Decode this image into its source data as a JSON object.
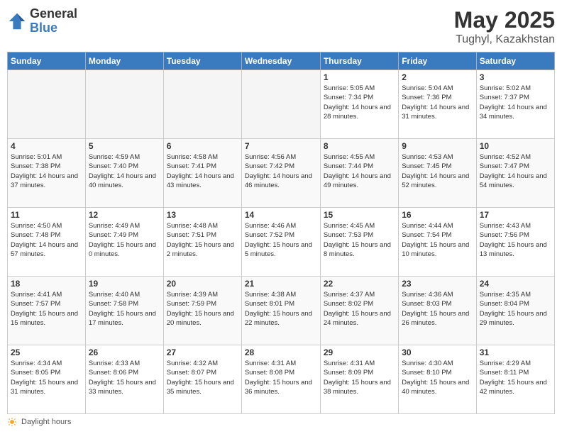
{
  "header": {
    "logo_general": "General",
    "logo_blue": "Blue",
    "month_year": "May 2025",
    "location": "Tughyl, Kazakhstan"
  },
  "days_of_week": [
    "Sunday",
    "Monday",
    "Tuesday",
    "Wednesday",
    "Thursday",
    "Friday",
    "Saturday"
  ],
  "weeks": [
    [
      {
        "day": "",
        "sunrise": "",
        "sunset": "",
        "daylight": ""
      },
      {
        "day": "",
        "sunrise": "",
        "sunset": "",
        "daylight": ""
      },
      {
        "day": "",
        "sunrise": "",
        "sunset": "",
        "daylight": ""
      },
      {
        "day": "",
        "sunrise": "",
        "sunset": "",
        "daylight": ""
      },
      {
        "day": "1",
        "sunrise": "Sunrise: 5:05 AM",
        "sunset": "Sunset: 7:34 PM",
        "daylight": "Daylight: 14 hours and 28 minutes."
      },
      {
        "day": "2",
        "sunrise": "Sunrise: 5:04 AM",
        "sunset": "Sunset: 7:36 PM",
        "daylight": "Daylight: 14 hours and 31 minutes."
      },
      {
        "day": "3",
        "sunrise": "Sunrise: 5:02 AM",
        "sunset": "Sunset: 7:37 PM",
        "daylight": "Daylight: 14 hours and 34 minutes."
      }
    ],
    [
      {
        "day": "4",
        "sunrise": "Sunrise: 5:01 AM",
        "sunset": "Sunset: 7:38 PM",
        "daylight": "Daylight: 14 hours and 37 minutes."
      },
      {
        "day": "5",
        "sunrise": "Sunrise: 4:59 AM",
        "sunset": "Sunset: 7:40 PM",
        "daylight": "Daylight: 14 hours and 40 minutes."
      },
      {
        "day": "6",
        "sunrise": "Sunrise: 4:58 AM",
        "sunset": "Sunset: 7:41 PM",
        "daylight": "Daylight: 14 hours and 43 minutes."
      },
      {
        "day": "7",
        "sunrise": "Sunrise: 4:56 AM",
        "sunset": "Sunset: 7:42 PM",
        "daylight": "Daylight: 14 hours and 46 minutes."
      },
      {
        "day": "8",
        "sunrise": "Sunrise: 4:55 AM",
        "sunset": "Sunset: 7:44 PM",
        "daylight": "Daylight: 14 hours and 49 minutes."
      },
      {
        "day": "9",
        "sunrise": "Sunrise: 4:53 AM",
        "sunset": "Sunset: 7:45 PM",
        "daylight": "Daylight: 14 hours and 52 minutes."
      },
      {
        "day": "10",
        "sunrise": "Sunrise: 4:52 AM",
        "sunset": "Sunset: 7:47 PM",
        "daylight": "Daylight: 14 hours and 54 minutes."
      }
    ],
    [
      {
        "day": "11",
        "sunrise": "Sunrise: 4:50 AM",
        "sunset": "Sunset: 7:48 PM",
        "daylight": "Daylight: 14 hours and 57 minutes."
      },
      {
        "day": "12",
        "sunrise": "Sunrise: 4:49 AM",
        "sunset": "Sunset: 7:49 PM",
        "daylight": "Daylight: 15 hours and 0 minutes."
      },
      {
        "day": "13",
        "sunrise": "Sunrise: 4:48 AM",
        "sunset": "Sunset: 7:51 PM",
        "daylight": "Daylight: 15 hours and 2 minutes."
      },
      {
        "day": "14",
        "sunrise": "Sunrise: 4:46 AM",
        "sunset": "Sunset: 7:52 PM",
        "daylight": "Daylight: 15 hours and 5 minutes."
      },
      {
        "day": "15",
        "sunrise": "Sunrise: 4:45 AM",
        "sunset": "Sunset: 7:53 PM",
        "daylight": "Daylight: 15 hours and 8 minutes."
      },
      {
        "day": "16",
        "sunrise": "Sunrise: 4:44 AM",
        "sunset": "Sunset: 7:54 PM",
        "daylight": "Daylight: 15 hours and 10 minutes."
      },
      {
        "day": "17",
        "sunrise": "Sunrise: 4:43 AM",
        "sunset": "Sunset: 7:56 PM",
        "daylight": "Daylight: 15 hours and 13 minutes."
      }
    ],
    [
      {
        "day": "18",
        "sunrise": "Sunrise: 4:41 AM",
        "sunset": "Sunset: 7:57 PM",
        "daylight": "Daylight: 15 hours and 15 minutes."
      },
      {
        "day": "19",
        "sunrise": "Sunrise: 4:40 AM",
        "sunset": "Sunset: 7:58 PM",
        "daylight": "Daylight: 15 hours and 17 minutes."
      },
      {
        "day": "20",
        "sunrise": "Sunrise: 4:39 AM",
        "sunset": "Sunset: 7:59 PM",
        "daylight": "Daylight: 15 hours and 20 minutes."
      },
      {
        "day": "21",
        "sunrise": "Sunrise: 4:38 AM",
        "sunset": "Sunset: 8:01 PM",
        "daylight": "Daylight: 15 hours and 22 minutes."
      },
      {
        "day": "22",
        "sunrise": "Sunrise: 4:37 AM",
        "sunset": "Sunset: 8:02 PM",
        "daylight": "Daylight: 15 hours and 24 minutes."
      },
      {
        "day": "23",
        "sunrise": "Sunrise: 4:36 AM",
        "sunset": "Sunset: 8:03 PM",
        "daylight": "Daylight: 15 hours and 26 minutes."
      },
      {
        "day": "24",
        "sunrise": "Sunrise: 4:35 AM",
        "sunset": "Sunset: 8:04 PM",
        "daylight": "Daylight: 15 hours and 29 minutes."
      }
    ],
    [
      {
        "day": "25",
        "sunrise": "Sunrise: 4:34 AM",
        "sunset": "Sunset: 8:05 PM",
        "daylight": "Daylight: 15 hours and 31 minutes."
      },
      {
        "day": "26",
        "sunrise": "Sunrise: 4:33 AM",
        "sunset": "Sunset: 8:06 PM",
        "daylight": "Daylight: 15 hours and 33 minutes."
      },
      {
        "day": "27",
        "sunrise": "Sunrise: 4:32 AM",
        "sunset": "Sunset: 8:07 PM",
        "daylight": "Daylight: 15 hours and 35 minutes."
      },
      {
        "day": "28",
        "sunrise": "Sunrise: 4:31 AM",
        "sunset": "Sunset: 8:08 PM",
        "daylight": "Daylight: 15 hours and 36 minutes."
      },
      {
        "day": "29",
        "sunrise": "Sunrise: 4:31 AM",
        "sunset": "Sunset: 8:09 PM",
        "daylight": "Daylight: 15 hours and 38 minutes."
      },
      {
        "day": "30",
        "sunrise": "Sunrise: 4:30 AM",
        "sunset": "Sunset: 8:10 PM",
        "daylight": "Daylight: 15 hours and 40 minutes."
      },
      {
        "day": "31",
        "sunrise": "Sunrise: 4:29 AM",
        "sunset": "Sunset: 8:11 PM",
        "daylight": "Daylight: 15 hours and 42 minutes."
      }
    ]
  ],
  "footer": {
    "daylight_label": "Daylight hours"
  }
}
